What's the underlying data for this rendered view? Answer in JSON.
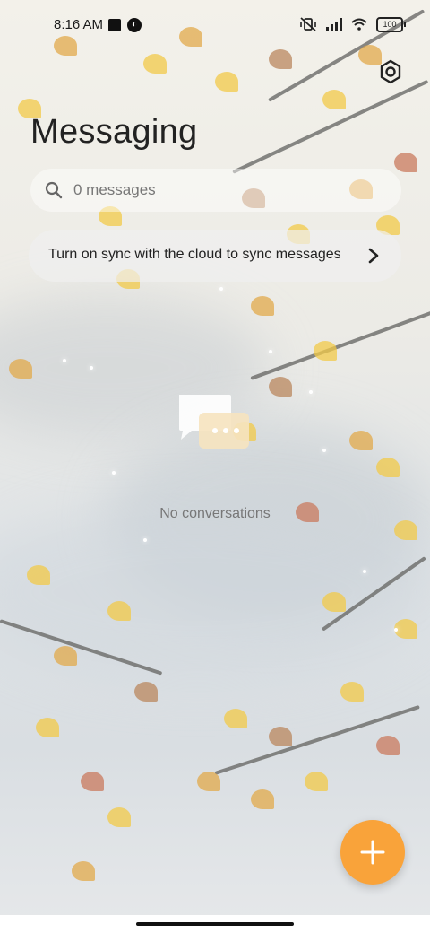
{
  "status_bar": {
    "time": "8:16 AM",
    "notification_icons": [
      "app-square-icon",
      "app-circle-icon"
    ],
    "system_icons": [
      "muted-vibrate-icon",
      "signal-icon",
      "wifi-icon",
      "battery-icon"
    ],
    "battery_level": "100"
  },
  "header": {
    "title": "Messaging",
    "settings_icon": "gear-icon"
  },
  "search": {
    "placeholder": "0 messages",
    "icon": "search-icon"
  },
  "sync_banner": {
    "text": "Turn on sync with the cloud to sync messages",
    "icon": "chevron-right-icon"
  },
  "empty_state": {
    "icon": "chat-bubbles-icon",
    "text": "No conversations"
  },
  "fab": {
    "icon": "plus-icon",
    "color": "#f9a33a"
  }
}
